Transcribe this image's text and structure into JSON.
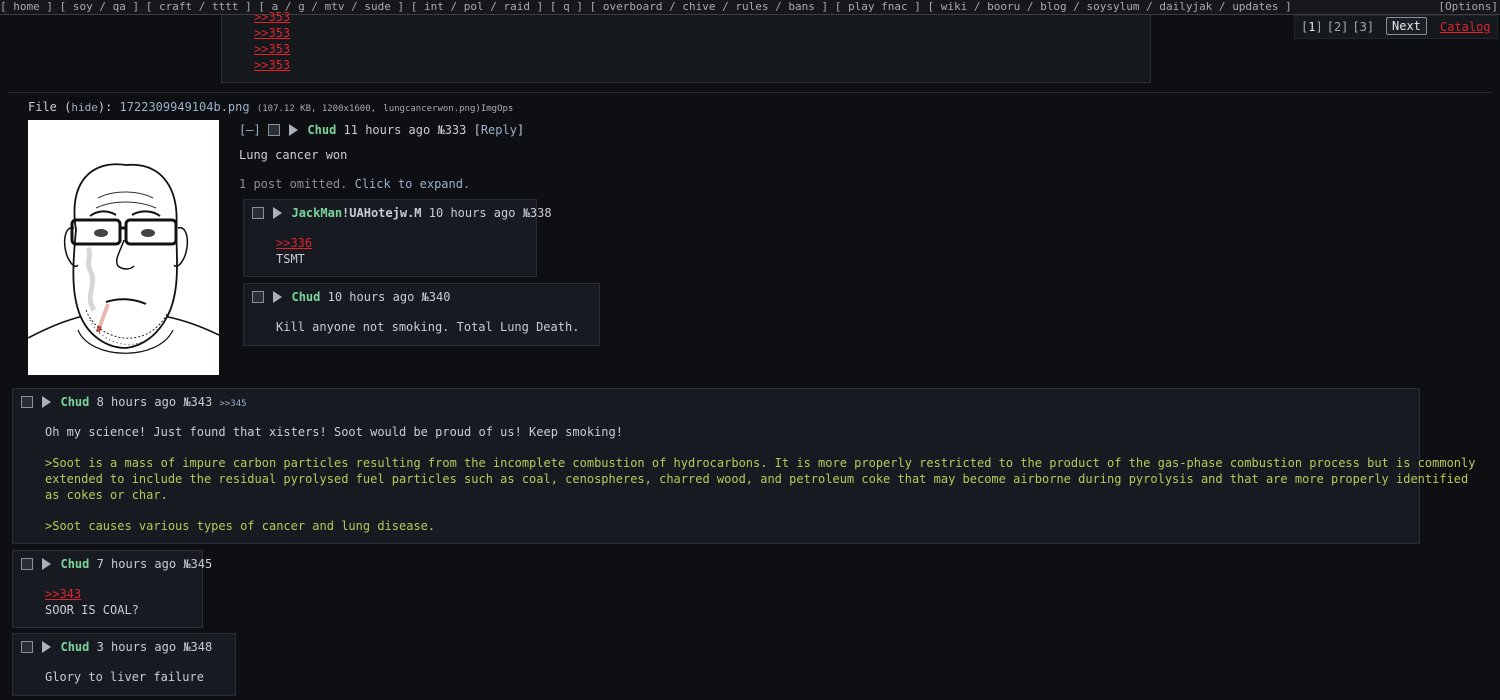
{
  "topbar": {
    "groups": [
      [
        "home"
      ],
      [
        "soy",
        "qa"
      ],
      [
        "craft",
        "tttt"
      ],
      [
        "a",
        "g",
        "mtv",
        "sude"
      ],
      [
        "int",
        "pol",
        "raid"
      ],
      [
        "q"
      ],
      [
        "overboard",
        "chive",
        "rules",
        "bans"
      ],
      [
        "play fnac"
      ],
      [
        "wiki",
        "booru",
        "blog",
        "soysylum",
        "dailyjak",
        "updates"
      ]
    ],
    "options": "[Options]"
  },
  "pagination": {
    "pages": [
      "1",
      "2",
      "3"
    ],
    "next": "Next",
    "catalog": "Catalog"
  },
  "prev_tail": {
    "links": [
      ">>353",
      ">>353",
      ">>353",
      ">>353"
    ]
  },
  "file": {
    "label": "File",
    "hide": "hide",
    "filename": "1722309949104b.png",
    "meta": "(107.12 KB, 1200x1600,",
    "original_name": "lungcancerwon.png",
    "imgops": "ImgOps"
  },
  "op": {
    "collapse": "[–]",
    "name": "Chud",
    "time": "11 hours ago",
    "no": "№333",
    "reply": "Reply",
    "body": "Lung cancer won",
    "omitted_text": "1 post omitted.",
    "expand": "Click to expand"
  },
  "replies": [
    {
      "name": "JackMan",
      "trip": "!UAHotejw.M",
      "time": "10 hours ago",
      "no": "№338",
      "quote_link": ">>336",
      "body": "TSMT"
    },
    {
      "name": "Chud",
      "time": "10 hours ago",
      "no": "№340",
      "body": "Kill anyone not smoking. Total Lung Death."
    },
    {
      "name": "Chud",
      "time": "8 hours ago",
      "no": "№343",
      "backlink": ">>345",
      "body": "Oh my science! Just found that xisters! Soot would be proud of us! Keep smoking!",
      "greentext1_line1": ">Soot is a mass of impure carbon particles resulting from the incomplete combustion of hydrocarbons. It is more properly restricted to the product of the gas-phase combustion process but is commonly",
      "greentext1_line2": "extended to include the residual pyrolysed fuel particles such as coal, cenospheres, charred wood, and petroleum coke that may become airborne during pyrolysis and that are more properly identified",
      "greentext1_line3": "as cokes or char.",
      "greentext2": ">Soot causes various types of cancer and lung disease."
    },
    {
      "name": "Chud",
      "time": "7 hours ago",
      "no": "№345",
      "quote_link": ">>343",
      "body": "SOOR IS COAL?"
    },
    {
      "name": "Chud",
      "time": "3 hours ago",
      "no": "№348",
      "body": "Glory to liver failure"
    }
  ]
}
